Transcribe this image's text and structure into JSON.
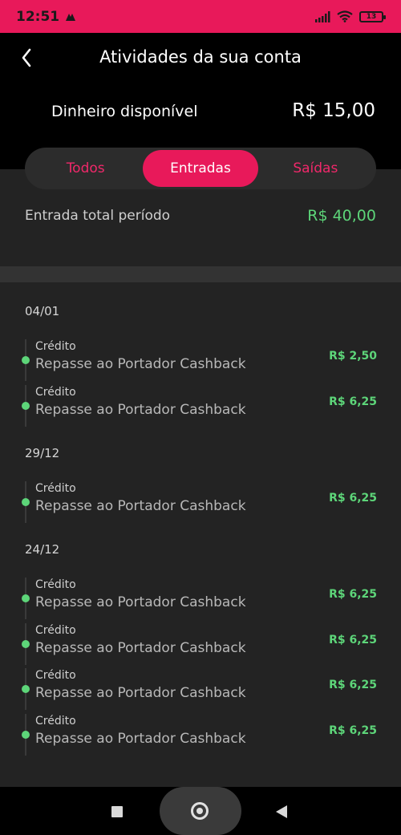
{
  "status": {
    "time": "12:51",
    "battery": "13"
  },
  "header": {
    "title": "Atividades da sua conta",
    "balance_label": "Dinheiro disponível",
    "balance_value": "R$ 15,00"
  },
  "tabs": [
    {
      "label": "Todos"
    },
    {
      "label": "Entradas"
    },
    {
      "label": "Saídas"
    }
  ],
  "summary": {
    "label": "Entrada total período",
    "value": "R$ 40,00"
  },
  "groups": [
    {
      "date": "04/01",
      "items": [
        {
          "kind": "Crédito",
          "desc": "Repasse ao Portador Cashback",
          "amount": "R$ 2,50"
        },
        {
          "kind": "Crédito",
          "desc": "Repasse ao Portador Cashback",
          "amount": "R$ 6,25"
        }
      ]
    },
    {
      "date": "29/12",
      "items": [
        {
          "kind": "Crédito",
          "desc": "Repasse ao Portador Cashback",
          "amount": "R$ 6,25"
        }
      ]
    },
    {
      "date": "24/12",
      "items": [
        {
          "kind": "Crédito",
          "desc": "Repasse ao Portador Cashback",
          "amount": "R$ 6,25"
        },
        {
          "kind": "Crédito",
          "desc": "Repasse ao Portador Cashback",
          "amount": "R$ 6,25"
        },
        {
          "kind": "Crédito",
          "desc": "Repasse ao Portador Cashback",
          "amount": "R$ 6,25"
        },
        {
          "kind": "Crédito",
          "desc": "Repasse ao Portador Cashback",
          "amount": "R$ 6,25"
        }
      ]
    }
  ],
  "colors": {
    "accent": "#e8195a",
    "positive": "#5dd579",
    "background": "#232323"
  },
  "icons": {
    "back": "chevron-left-icon",
    "signal": "signal-icon",
    "wifi": "wifi-icon",
    "battery": "battery-icon"
  }
}
